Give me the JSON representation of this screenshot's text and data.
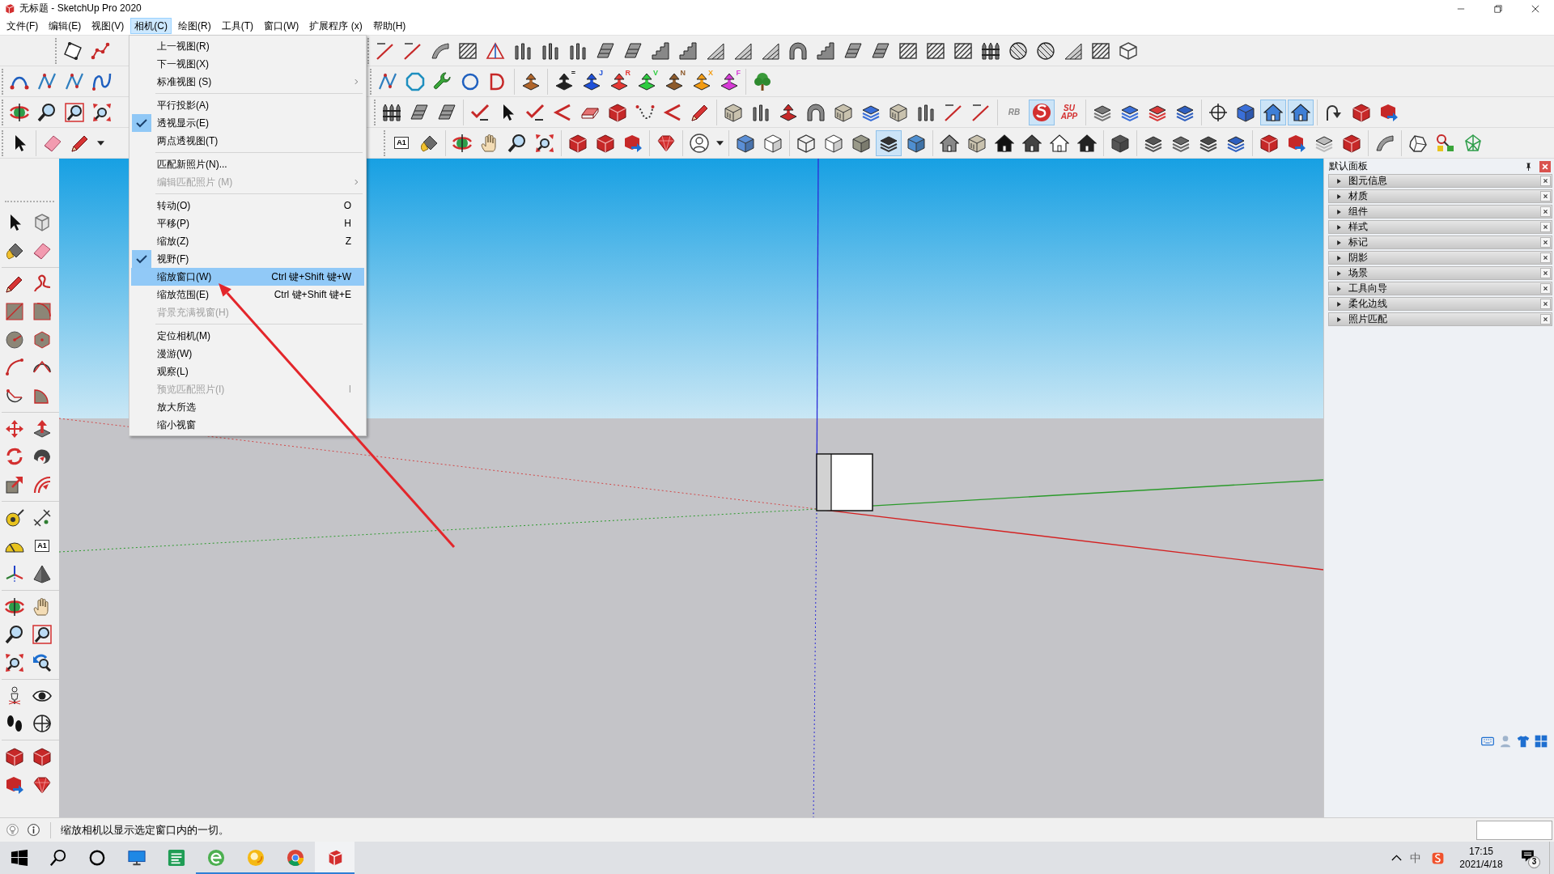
{
  "window": {
    "title": "无标题 - SketchUp Pro 2020"
  },
  "menu_bar": [
    {
      "label": "文件(F)",
      "selected": false
    },
    {
      "label": "编辑(E)",
      "selected": false
    },
    {
      "label": "视图(V)",
      "selected": false
    },
    {
      "label": "相机(C)",
      "selected": true
    },
    {
      "label": "绘图(R)",
      "selected": false
    },
    {
      "label": "工具(T)",
      "selected": false
    },
    {
      "label": "窗口(W)",
      "selected": false
    },
    {
      "label": "扩展程序 (x)",
      "selected": false
    },
    {
      "label": "帮助(H)",
      "selected": false
    }
  ],
  "toolbars": [
    {
      "left": [
        [
          {
            "kind": "tiltsquare"
          },
          {
            "kind": "polyline"
          }
        ]
      ],
      "right": [
        [
          {
            "kind": "line"
          },
          {
            "kind": "line"
          },
          {
            "kind": "swoosh"
          },
          {
            "kind": "hatch"
          },
          {
            "kind": "wedge"
          },
          {
            "kind": "columns"
          },
          {
            "kind": "columns"
          },
          {
            "kind": "columns"
          },
          {
            "kind": "panel"
          },
          {
            "kind": "panel"
          },
          {
            "kind": "stairs"
          },
          {
            "kind": "stairs"
          },
          {
            "kind": "ramp"
          },
          {
            "kind": "ramp"
          },
          {
            "kind": "ramp"
          },
          {
            "kind": "arch"
          },
          {
            "kind": "stairs"
          },
          {
            "kind": "panel"
          },
          {
            "kind": "panel"
          },
          {
            "kind": "hatch"
          },
          {
            "kind": "hatch"
          },
          {
            "kind": "hatch"
          },
          {
            "kind": "fence"
          },
          {
            "kind": "dome"
          },
          {
            "kind": "dome"
          },
          {
            "kind": "ramp"
          },
          {
            "kind": "hatch"
          },
          {
            "kind": "hexprism"
          }
        ]
      ]
    },
    {
      "left": [
        [
          {
            "kind": "curve"
          },
          {
            "kind": "zigzag"
          },
          {
            "kind": "zigzag"
          },
          {
            "kind": "scurve"
          }
        ]
      ],
      "right": [
        [
          {
            "kind": "zigzag"
          },
          {
            "kind": "polyring"
          },
          {
            "kind": "wrench"
          },
          {
            "kind": "ring"
          },
          {
            "kind": "loop"
          }
        ],
        [
          {
            "kind": "pushbox",
            "color": "#b0652a"
          }
        ],
        [
          {
            "kind": "pushbox",
            "color": "#222222",
            "text": "="
          },
          {
            "kind": "pushbox",
            "color": "#1e50d8",
            "text": "J"
          },
          {
            "kind": "pushbox",
            "color": "#e53935",
            "text": "R"
          },
          {
            "kind": "pushbox",
            "color": "#2ecc40",
            "text": "V"
          },
          {
            "kind": "pushbox",
            "color": "#8d5a2b",
            "text": "N"
          },
          {
            "kind": "pushbox",
            "color": "#f39c12",
            "text": "X"
          },
          {
            "kind": "pushbox",
            "color": "#d63ad6",
            "text": "F"
          }
        ],
        [
          {
            "kind": "tree"
          }
        ]
      ]
    },
    {
      "left": [
        [
          {
            "kind": "orbit",
            "pressed": false
          },
          {
            "kind": "magnifier",
            "pressed": false
          },
          {
            "kind": "zoomwin",
            "pressed": false
          },
          {
            "kind": "extents",
            "pressed": false
          }
        ]
      ],
      "right": [
        [
          {
            "kind": "fence",
            "pressed": false
          },
          {
            "kind": "panel",
            "pressed": false
          },
          {
            "kind": "panel",
            "pressed": false
          }
        ],
        [
          {
            "kind": "check",
            "pressed": false
          },
          {
            "kind": "cursor",
            "pressed": false
          },
          {
            "kind": "check",
            "pressed": false
          },
          {
            "kind": "chevron",
            "pressed": false
          },
          {
            "kind": "slab",
            "pressed": false
          },
          {
            "kind": "boxes",
            "pressed": false
          },
          {
            "kind": "dotted",
            "pressed": false
          },
          {
            "kind": "chevron",
            "pressed": false
          },
          {
            "kind": "pencil",
            "pressed": false
          }
        ],
        [
          {
            "kind": "crate",
            "pressed": false
          },
          {
            "kind": "columns",
            "pressed": false
          },
          {
            "kind": "pushbox",
            "color": "#c62828",
            "pressed": false
          },
          {
            "kind": "arch",
            "pressed": false
          },
          {
            "kind": "crate",
            "pressed": false
          },
          {
            "kind": "layers",
            "color": "#3a6fd8",
            "pressed": false
          },
          {
            "kind": "crate",
            "pressed": false
          },
          {
            "kind": "columns",
            "pressed": false
          },
          {
            "kind": "line",
            "pressed": false
          },
          {
            "kind": "line",
            "pressed": false
          }
        ],
        [
          {
            "kind": "label",
            "text": "RB",
            "color": "#8a8a8a",
            "pressed": false
          },
          {
            "kind": "swirldisc",
            "pressed": true
          },
          {
            "kind": "label",
            "text": "SU APP",
            "color": "#d32f2f",
            "pressed": false
          }
        ],
        [
          {
            "kind": "layers",
            "color": "#777777",
            "pressed": false
          },
          {
            "kind": "layers",
            "color": "#3a6fd8",
            "pressed": false
          },
          {
            "kind": "layers",
            "color": "#d83a3a",
            "pressed": false
          },
          {
            "kind": "layers",
            "color": "#2f5fbf",
            "pressed": false
          }
        ],
        [
          {
            "kind": "crosshair",
            "pressed": false
          },
          {
            "kind": "cube",
            "color": "#3a6fd8",
            "pressed": false
          },
          {
            "kind": "house",
            "color": "#3f7fd6",
            "pressed": true
          },
          {
            "kind": "house",
            "color": "#3f7fd6",
            "pressed": true
          }
        ],
        [
          {
            "kind": "curvearrow",
            "pressed": false
          },
          {
            "kind": "boxes",
            "pressed": false
          },
          {
            "kind": "share",
            "pressed": false
          }
        ]
      ]
    },
    {
      "left": [
        [
          {
            "kind": "cursor",
            "pressed": false
          }
        ],
        [
          {
            "kind": "eraser",
            "pressed": false
          },
          {
            "kind": "pencil",
            "pressed": false
          },
          {
            "kind": "caret",
            "pressed": false
          }
        ]
      ],
      "right": [
        [
          {
            "kind": "textlabel",
            "text": "A1",
            "pressed": false
          },
          {
            "kind": "bucket",
            "pressed": false
          }
        ],
        [
          {
            "kind": "orbit",
            "pressed": false
          },
          {
            "kind": "hand",
            "pressed": false
          },
          {
            "kind": "magnifier",
            "pressed": false
          },
          {
            "kind": "extents",
            "pressed": false
          }
        ],
        [
          {
            "kind": "boxes",
            "pressed": false
          },
          {
            "kind": "boxes",
            "pressed": false
          },
          {
            "kind": "share",
            "pressed": false
          }
        ],
        [
          {
            "kind": "gem",
            "pressed": false
          }
        ],
        [
          {
            "kind": "usercircle",
            "pressed": false
          },
          {
            "kind": "caret",
            "pressed": false
          }
        ],
        [
          {
            "kind": "cube",
            "color": "#5b8fd6",
            "pressed": false
          },
          {
            "kind": "cube",
            "color": "#ffffff",
            "pressed": false
          }
        ],
        [
          {
            "kind": "wirecube",
            "pressed": false
          },
          {
            "kind": "cube",
            "color": "#ffffff",
            "pressed": false
          },
          {
            "kind": "cube",
            "color": "#9a9a8a",
            "pressed": false
          },
          {
            "kind": "layers",
            "color": "#333333",
            "pressed": true
          },
          {
            "kind": "cube",
            "color": "#4f8fd0",
            "pressed": false
          }
        ],
        [
          {
            "kind": "house",
            "color": "#888888",
            "pressed": false
          },
          {
            "kind": "crate",
            "pressed": false
          },
          {
            "kind": "house",
            "color": "#111111",
            "pressed": false
          },
          {
            "kind": "house",
            "color": "#444444",
            "pressed": false
          },
          {
            "kind": "house",
            "color": "#ffffff",
            "pressed": false
          },
          {
            "kind": "house",
            "color": "#222222",
            "pressed": false
          }
        ],
        [
          {
            "kind": "cube",
            "color": "#555555",
            "pressed": false
          }
        ],
        [
          {
            "kind": "layers",
            "color": "#555555",
            "pressed": false
          },
          {
            "kind": "layers",
            "color": "#666666",
            "pressed": false
          },
          {
            "kind": "layers",
            "color": "#4a4a4a",
            "pressed": false
          },
          {
            "kind": "layers",
            "color": "#2f5fbf",
            "pressed": false
          }
        ],
        [
          {
            "kind": "boxes",
            "pressed": false
          },
          {
            "kind": "share",
            "pressed": false
          },
          {
            "kind": "layers",
            "color": "#bbbbbb",
            "pressed": false
          },
          {
            "kind": "boxes",
            "pressed": false
          }
        ],
        [
          {
            "kind": "swoosh",
            "pressed": false
          }
        ],
        [
          {
            "kind": "rock",
            "pressed": false
          },
          {
            "kind": "nodes",
            "pressed": false
          },
          {
            "kind": "wiretree",
            "pressed": false
          }
        ]
      ]
    }
  ],
  "side_toolbar": [
    [
      {
        "kind": "cursor"
      },
      {
        "kind": "wirebox"
      },
      {
        "kind": "bucket"
      },
      {
        "kind": "eraser"
      }
    ],
    [
      {
        "kind": "pencil"
      },
      {
        "kind": "squiggle"
      },
      {
        "kind": "rect"
      },
      {
        "kind": "rotrect"
      },
      {
        "kind": "circle"
      },
      {
        "kind": "polygon"
      },
      {
        "kind": "arc"
      },
      {
        "kind": "halfarc"
      },
      {
        "kind": "arcdots"
      },
      {
        "kind": "pie"
      }
    ],
    [
      {
        "kind": "move"
      },
      {
        "kind": "pushpull"
      },
      {
        "kind": "rotate"
      },
      {
        "kind": "swirl"
      },
      {
        "kind": "scale"
      },
      {
        "kind": "offset"
      }
    ],
    [
      {
        "kind": "tape"
      },
      {
        "kind": "dimension"
      },
      {
        "kind": "protractor"
      },
      {
        "kind": "textlabel",
        "text": "A1"
      },
      {
        "kind": "axes"
      },
      {
        "kind": "prism"
      }
    ],
    [
      {
        "kind": "orbit"
      },
      {
        "kind": "hand"
      },
      {
        "kind": "magnifier"
      },
      {
        "kind": "zoomwin"
      },
      {
        "kind": "extents"
      },
      {
        "kind": "previous"
      }
    ],
    [
      {
        "kind": "person"
      },
      {
        "kind": "eye"
      },
      {
        "kind": "footprints"
      },
      {
        "kind": "section"
      }
    ],
    [
      {
        "kind": "boxes"
      },
      {
        "kind": "boxes"
      },
      {
        "kind": "share"
      },
      {
        "kind": "gem"
      }
    ]
  ],
  "camera_menu": {
    "groups": [
      [
        {
          "label": "上一视图(R)",
          "checked": false,
          "selected": false,
          "disabled": false,
          "submenu": false
        },
        {
          "label": "下一视图(X)",
          "checked": false,
          "selected": false,
          "disabled": false,
          "submenu": false
        },
        {
          "label": "标准视图 (S)",
          "checked": false,
          "selected": false,
          "disabled": false,
          "submenu": true
        }
      ],
      [
        {
          "label": "平行投影(A)",
          "checked": false,
          "selected": false,
          "disabled": false,
          "submenu": false
        },
        {
          "label": "透视显示(E)",
          "checked": true,
          "selected": false,
          "disabled": false,
          "submenu": false
        },
        {
          "label": "两点透视图(T)",
          "checked": false,
          "selected": false,
          "disabled": false,
          "submenu": false
        }
      ],
      [
        {
          "label": "匹配新照片(N)...",
          "checked": false,
          "selected": false,
          "disabled": false,
          "submenu": false
        },
        {
          "label": "编辑匹配照片 (M)",
          "checked": false,
          "selected": false,
          "disabled": true,
          "submenu": true
        }
      ],
      [
        {
          "label": "转动(O)",
          "shortcut": "O",
          "checked": false,
          "selected": false,
          "disabled": false,
          "submenu": false
        },
        {
          "label": "平移(P)",
          "shortcut": "H",
          "checked": false,
          "selected": false,
          "disabled": false,
          "submenu": false
        },
        {
          "label": "缩放(Z)",
          "shortcut": "Z",
          "checked": false,
          "selected": false,
          "disabled": false,
          "submenu": false
        },
        {
          "label": "视野(F)",
          "checked": true,
          "selected": false,
          "disabled": false,
          "submenu": false
        },
        {
          "label": "缩放窗口(W)",
          "shortcut": "Ctrl 键+Shift 键+W",
          "checked": false,
          "selected": true,
          "disabled": false,
          "submenu": false
        },
        {
          "label": "缩放范围(E)",
          "shortcut": "Ctrl 键+Shift 键+E",
          "checked": false,
          "selected": false,
          "disabled": false,
          "submenu": false
        },
        {
          "label": "背景充满视窗(H)",
          "checked": false,
          "selected": false,
          "disabled": true,
          "submenu": false
        }
      ],
      [
        {
          "label": "定位相机(M)",
          "checked": false,
          "selected": false,
          "disabled": false,
          "submenu": false
        },
        {
          "label": "漫游(W)",
          "checked": false,
          "selected": false,
          "disabled": false,
          "submenu": false
        },
        {
          "label": "观察(L)",
          "checked": false,
          "selected": false,
          "disabled": false,
          "submenu": false
        },
        {
          "label": "预览匹配照片(I)",
          "shortcut": "I",
          "checked": false,
          "selected": false,
          "disabled": true,
          "submenu": false
        },
        {
          "label": "放大所选",
          "checked": false,
          "selected": false,
          "disabled": false,
          "submenu": false
        },
        {
          "label": "缩小视窗",
          "checked": false,
          "selected": false,
          "disabled": false,
          "submenu": false
        }
      ]
    ]
  },
  "default_tray": {
    "title": "默认面板",
    "panels": [
      {
        "label": "图元信息",
        "expanded": false
      },
      {
        "label": "材质",
        "expanded": false
      },
      {
        "label": "组件",
        "expanded": false
      },
      {
        "label": "样式",
        "expanded": false
      },
      {
        "label": "标记",
        "expanded": false
      },
      {
        "label": "阴影",
        "expanded": false
      },
      {
        "label": "场景",
        "expanded": false
      },
      {
        "label": "工具向导",
        "expanded": false
      },
      {
        "label": "柔化边线",
        "expanded": false
      },
      {
        "label": "照片匹配",
        "expanded": false
      }
    ]
  },
  "status_bar": {
    "hint": "缩放相机以显示选定窗口内的一切。"
  },
  "taskbar": {
    "apps": [
      {
        "kind": "monitor",
        "running": false,
        "active": false
      },
      {
        "kind": "tile",
        "running": false,
        "active": false
      },
      {
        "kind": "globe",
        "running": true,
        "active": false
      },
      {
        "kind": "orb",
        "running": true,
        "active": false
      },
      {
        "kind": "wheel",
        "running": true,
        "active": false
      },
      {
        "kind": "logo",
        "running": true,
        "active": true
      }
    ],
    "input_mode": "中",
    "time": "17:15",
    "date": "2021/4/18",
    "notification_count": "3"
  }
}
